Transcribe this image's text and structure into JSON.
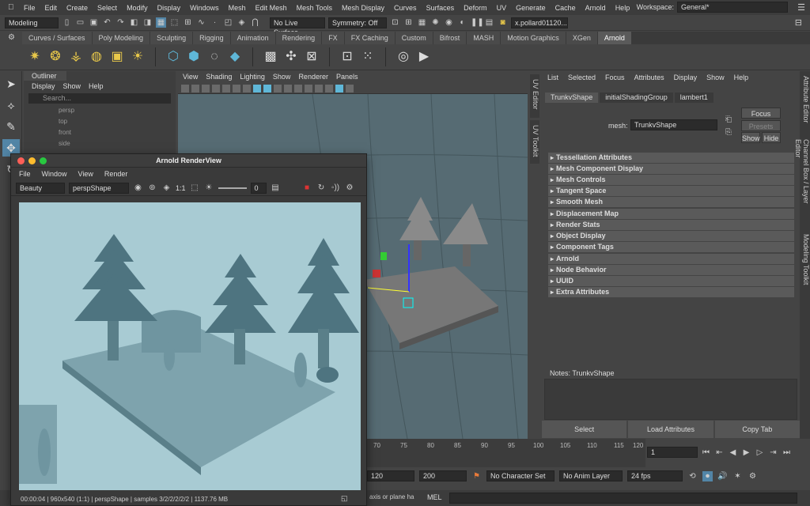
{
  "menubar": {
    "items": [
      "File",
      "Edit",
      "Create",
      "Select",
      "Modify",
      "Display",
      "Windows",
      "Mesh",
      "Edit Mesh",
      "Mesh Tools",
      "Mesh Display",
      "Curves",
      "Surfaces",
      "Deform",
      "UV",
      "Generate",
      "Cache",
      "Arnold",
      "Help"
    ],
    "workspace_label": "Workspace:",
    "workspace_value": "General*"
  },
  "statusline": {
    "mode": "Modeling",
    "live_surface": "No Live Surface",
    "symmetry": "Symmetry: Off",
    "user": "x.pollard01120..."
  },
  "shelf_tabs": [
    "Curves / Surfaces",
    "Poly Modeling",
    "Sculpting",
    "Rigging",
    "Animation",
    "Rendering",
    "FX",
    "FX Caching",
    "Custom",
    "Bifrost",
    "MASH",
    "Motion Graphics",
    "XGen",
    "Arnold"
  ],
  "shelf_active_tab": "Arnold",
  "outliner": {
    "title": "Outliner",
    "menu": [
      "Display",
      "Show",
      "Help"
    ],
    "search_placeholder": "Search...",
    "items": [
      "persp",
      "top",
      "front",
      "side"
    ]
  },
  "viewport": {
    "menu": [
      "View",
      "Shading",
      "Lighting",
      "Show",
      "Renderer",
      "Panels"
    ]
  },
  "side_tabs": {
    "left": [
      "UV Editor",
      "UV Toolkit"
    ],
    "right": [
      "Attribute Editor",
      "Channel Box / Layer Editor",
      "Modeling Toolkit"
    ]
  },
  "attribute_editor": {
    "menu": [
      "List",
      "Selected",
      "Focus",
      "Attributes",
      "Display",
      "Show",
      "Help"
    ],
    "tabs": [
      "TrunkvShape",
      "initialShadingGroup",
      "lambert1"
    ],
    "mesh_label": "mesh:",
    "mesh_value": "TrunkvShape",
    "focus_btn": "Focus",
    "presets_btn": "Presets",
    "show_btn": "Show",
    "hide_btn": "Hide",
    "sections": [
      "Tessellation Attributes",
      "Mesh Component Display",
      "Mesh Controls",
      "Tangent Space",
      "Smooth Mesh",
      "Displacement Map",
      "Render Stats",
      "Object Display",
      "Component Tags",
      "Arnold",
      "Node Behavior",
      "UUID",
      "Extra Attributes"
    ],
    "notes_label": "Notes:  TrunkvShape",
    "bottom_buttons": [
      "Select",
      "Load Attributes",
      "Copy Tab"
    ]
  },
  "timeslider": {
    "ticks": [
      "70",
      "75",
      "80",
      "85",
      "90",
      "95",
      "100",
      "105",
      "110",
      "115",
      "120"
    ],
    "current_frame": "1",
    "range_end1": "120",
    "range_end2": "200",
    "character_set": "No Character Set",
    "anim_layer": "No Anim Layer",
    "fps": "24 fps"
  },
  "cmdline": {
    "mode": "MEL",
    "help_text": "axis or plane ha"
  },
  "renderview": {
    "title": "Arnold RenderView",
    "menu": [
      "File",
      "Window",
      "View",
      "Render"
    ],
    "aov": "Beauty",
    "camera": "perspShape",
    "ratio": "1:1",
    "exposure": "0",
    "status": "00:00:04 | 960x540 (1:1) | perspShape | samples 3/2/2/2/2/2 | 1137.76 MB"
  }
}
